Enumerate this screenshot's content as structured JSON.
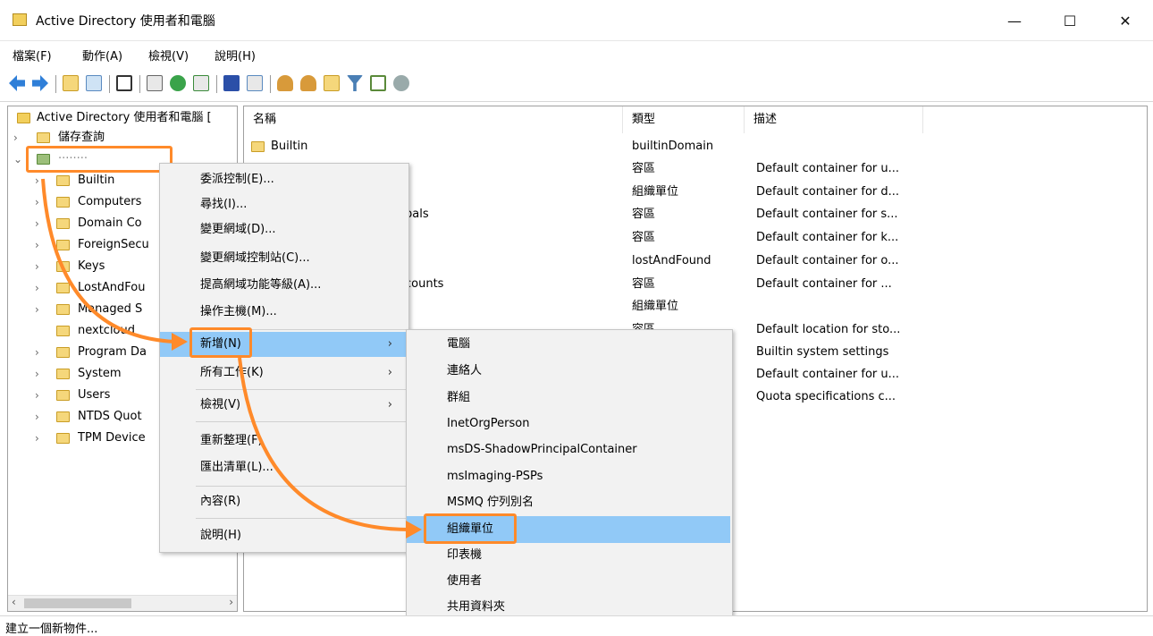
{
  "window": {
    "title": "Active Directory 使用者和電腦",
    "minimize_label": "—",
    "maximize_label": "☐",
    "close_label": "✕"
  },
  "menubar": [
    "檔案(F)",
    "動作(A)",
    "檢視(V)",
    "說明(H)"
  ],
  "toolbar": {
    "icons": [
      "back-icon",
      "forward-icon",
      "up-folder-icon",
      "show-tree-icon",
      "copy-icon",
      "properties-icon",
      "refresh-icon",
      "export-icon",
      "help-icon",
      "view-icon",
      "new-user-icon",
      "new-group-icon",
      "new-ou-icon",
      "filter-icon",
      "find-icon",
      "delegate-icon"
    ]
  },
  "tree": {
    "root": "Active Directory 使用者和電腦 [",
    "saved_queries": "儲存查詢",
    "domain": "········",
    "items": [
      "Builtin",
      "Computers",
      "Domain Co",
      "ForeignSecu",
      "Keys",
      "LostAndFou",
      "Managed S",
      "nextcloud",
      "Program Da",
      "System",
      "Users",
      "NTDS Quot",
      "TPM Device"
    ]
  },
  "list": {
    "columns": [
      "名稱",
      "類型",
      "描述"
    ],
    "names": [
      "Builtin",
      "",
      "",
      "pals",
      "",
      "",
      "counts",
      "",
      "",
      "",
      "",
      ""
    ],
    "types": [
      "builtinDomain",
      "容區",
      "組織單位",
      "容區",
      "容區",
      "lostAndFound",
      "容區",
      "組織單位",
      "容區",
      "",
      "",
      ""
    ],
    "descriptions": [
      "",
      "Default container for u...",
      "Default container for d...",
      "Default container for s...",
      "Default container for k...",
      "Default container for o...",
      "Default container for ...",
      "",
      "Default location for sto...",
      "Builtin system settings",
      "Default container for u...",
      "Quota specifications c..."
    ]
  },
  "context_menu": {
    "items": [
      "委派控制(E)...",
      "尋找(I)...",
      "變更網域(D)...",
      "變更網域控制站(C)...",
      "提高網域功能等級(A)...",
      "操作主機(M)...",
      "新增(N)",
      "所有工作(K)",
      "檢視(V)",
      "重新整理(F)",
      "匯出清單(L)...",
      "內容(R)",
      "說明(H)"
    ],
    "arrow": "›"
  },
  "submenu": {
    "items": [
      "電腦",
      "連絡人",
      "群組",
      "InetOrgPerson",
      "msDS-ShadowPrincipalContainer",
      "msImaging-PSPs",
      "MSMQ 佇列別名",
      "組織單位",
      "印表機",
      "使用者",
      "共用資料夾"
    ]
  },
  "statusbar": {
    "text": "建立一個新物件..."
  },
  "colors": {
    "highlight": "#91c9f7",
    "annotation": "#ff8a2a",
    "folder": "#f5d77b"
  }
}
